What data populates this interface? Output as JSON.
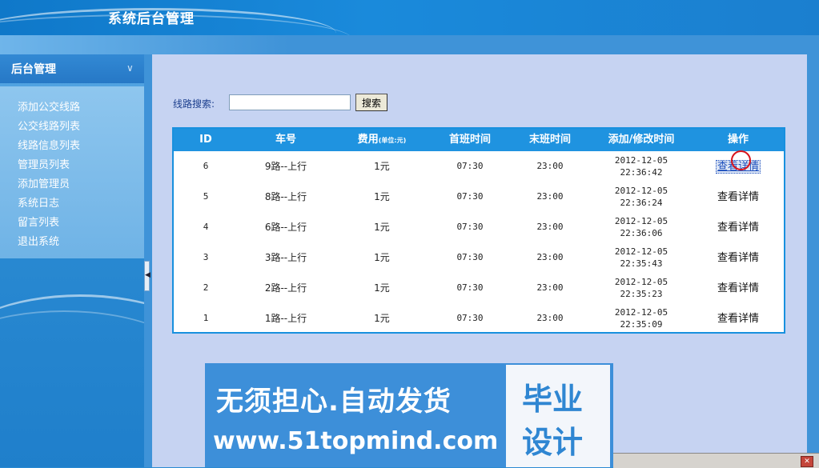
{
  "header": {
    "title": "系统后台管理"
  },
  "sidebar": {
    "title": "后台管理",
    "items": [
      {
        "label": "添加公交线路"
      },
      {
        "label": "公交线路列表"
      },
      {
        "label": "线路信息列表"
      },
      {
        "label": "管理员列表"
      },
      {
        "label": "添加管理员"
      },
      {
        "label": "系统日志"
      },
      {
        "label": "留言列表"
      },
      {
        "label": "退出系统"
      }
    ]
  },
  "search": {
    "label": "线路搜索:",
    "value": "",
    "button_label": "搜索"
  },
  "table": {
    "headers": {
      "id": "ID",
      "route": "车号",
      "fee": "费用",
      "fee_unit": "(单位:元)",
      "first": "首班时间",
      "last": "末班时间",
      "modified": "添加/修改时间",
      "action": "操作"
    },
    "rows": [
      {
        "id": "6",
        "route": "9路--上行",
        "fee": "1元",
        "first": "07:30",
        "last": "23:00",
        "date": "2012-12-05",
        "time": "22:36:42",
        "action": "查看详情"
      },
      {
        "id": "5",
        "route": "8路--上行",
        "fee": "1元",
        "first": "07:30",
        "last": "23:00",
        "date": "2012-12-05",
        "time": "22:36:24",
        "action": "查看详情"
      },
      {
        "id": "4",
        "route": "6路--上行",
        "fee": "1元",
        "first": "07:30",
        "last": "23:00",
        "date": "2012-12-05",
        "time": "22:36:06",
        "action": "查看详情"
      },
      {
        "id": "3",
        "route": "3路--上行",
        "fee": "1元",
        "first": "07:30",
        "last": "23:00",
        "date": "2012-12-05",
        "time": "22:35:43",
        "action": "查看详情"
      },
      {
        "id": "2",
        "route": "2路--上行",
        "fee": "1元",
        "first": "07:30",
        "last": "23:00",
        "date": "2012-12-05",
        "time": "22:35:23",
        "action": "查看详情"
      },
      {
        "id": "1",
        "route": "1路--上行",
        "fee": "1元",
        "first": "07:30",
        "last": "23:00",
        "date": "2012-12-05",
        "time": "22:35:09",
        "action": "查看详情"
      }
    ]
  },
  "watermark": {
    "line1": "无须担心.自动发货",
    "line2": "www.51topmind.com",
    "box_line1": "毕业",
    "box_line2": "设计"
  },
  "colors": {
    "header": "#1a8adb",
    "table_head": "#1f93e0",
    "content_bg": "#c6d3f2"
  }
}
